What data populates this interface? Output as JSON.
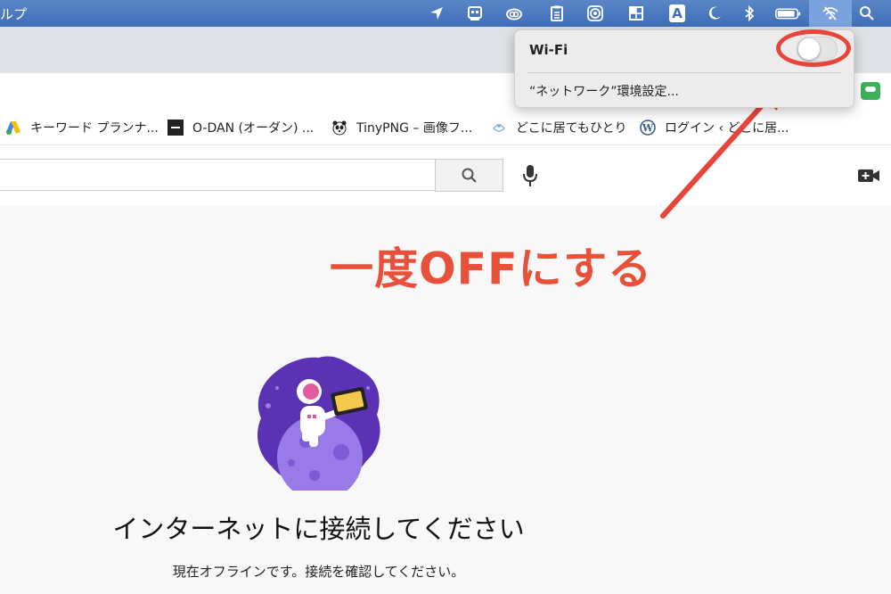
{
  "menubar": {
    "app_menu_partial": "ルプ",
    "icons": [
      "location-arrow-icon",
      "robot-app-icon",
      "creative-cloud-icon",
      "clipboard-icon",
      "target-icon",
      "window-tiles-icon",
      "input-source-icon",
      "moon-icon",
      "bluetooth-icon",
      "battery-icon",
      "wifi-off-icon",
      "spotlight-search-icon"
    ],
    "input_source_label": "A"
  },
  "bookmarks": [
    {
      "label": "キーワード プランナ...",
      "icon": "google-ads-icon"
    },
    {
      "label": "O-DAN (オーダン) ...",
      "icon": "odan-icon"
    },
    {
      "label": "TinyPNG – 画像フ...",
      "icon": "panda-icon"
    },
    {
      "label": "どこに居てもひとり",
      "icon": "site-icon"
    },
    {
      "label": "ログイン ‹ どこに居...",
      "icon": "wordpress-icon"
    }
  ],
  "wifi_panel": {
    "label": "Wi-Fi",
    "toggle_state": "off",
    "settings_link": "“ネットワーク”環境設定..."
  },
  "annotation": {
    "text": "一度OFFにする",
    "color": "#e8503a"
  },
  "offline": {
    "title": "インターネットに接続してください",
    "subtitle": "現在オフラインです。接続を確認してください。"
  },
  "colors": {
    "menubar": "#4a7bc2",
    "accent_red": "#e8453a",
    "illustration_purple": "#6b3fc6"
  }
}
